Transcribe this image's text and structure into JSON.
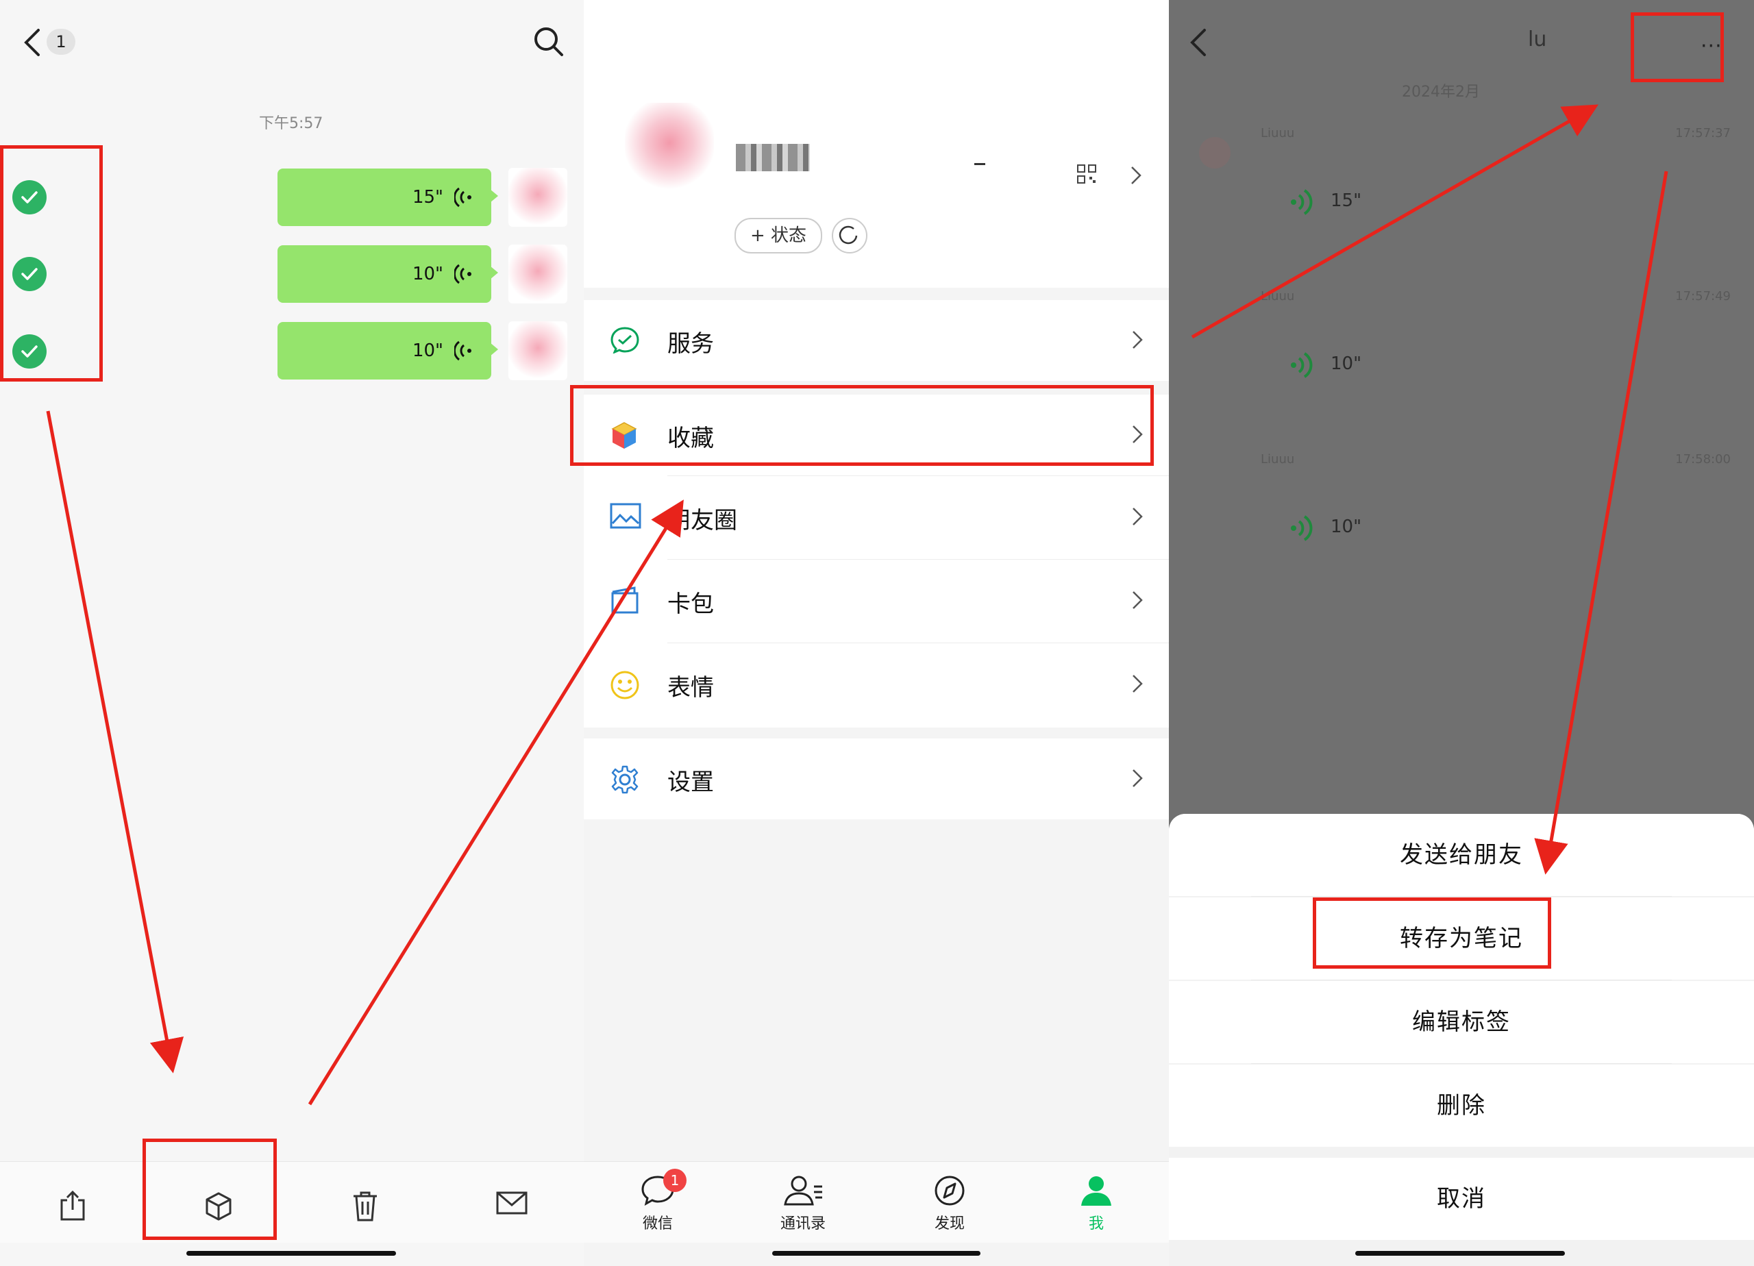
{
  "panel1": {
    "back_badge": "1",
    "timestamp": "下午5:57",
    "voice_messages": [
      {
        "duration": "15\""
      },
      {
        "duration": "10\""
      },
      {
        "duration": "10\""
      }
    ],
    "toolbar": [
      "share-icon",
      "favorite-box-icon",
      "trash-icon",
      "mail-icon"
    ]
  },
  "panel2": {
    "status_button": "+ 状态",
    "menu": [
      {
        "label": "服务",
        "icon": "service-icon"
      },
      {
        "label": "收藏",
        "icon": "favorites-cube-icon"
      },
      {
        "label": "朋友圈",
        "icon": "moments-picture-icon"
      },
      {
        "label": "卡包",
        "icon": "card-wallet-icon"
      },
      {
        "label": "表情",
        "icon": "smiley-icon"
      },
      {
        "label": "设置",
        "icon": "gear-icon"
      }
    ],
    "tabs": [
      {
        "label": "微信",
        "badge": "1"
      },
      {
        "label": "通讯录"
      },
      {
        "label": "发现"
      },
      {
        "label": "我"
      }
    ],
    "accent": "#07c160"
  },
  "panel3": {
    "title": "lu",
    "more": "···",
    "date": "2024年2月",
    "messages": [
      {
        "sender": "Liuuu",
        "time": "17:57:37",
        "duration": "15\""
      },
      {
        "sender": "Liuuu",
        "time": "17:57:49",
        "duration": "10\""
      },
      {
        "sender": "Liuuu",
        "time": "17:58:00",
        "duration": "10\""
      }
    ],
    "sheet_options": [
      "发送给朋友",
      "转存为笔记",
      "编辑标签",
      "删除"
    ],
    "cancel": "取消"
  },
  "annotation_color": "#e8231b"
}
